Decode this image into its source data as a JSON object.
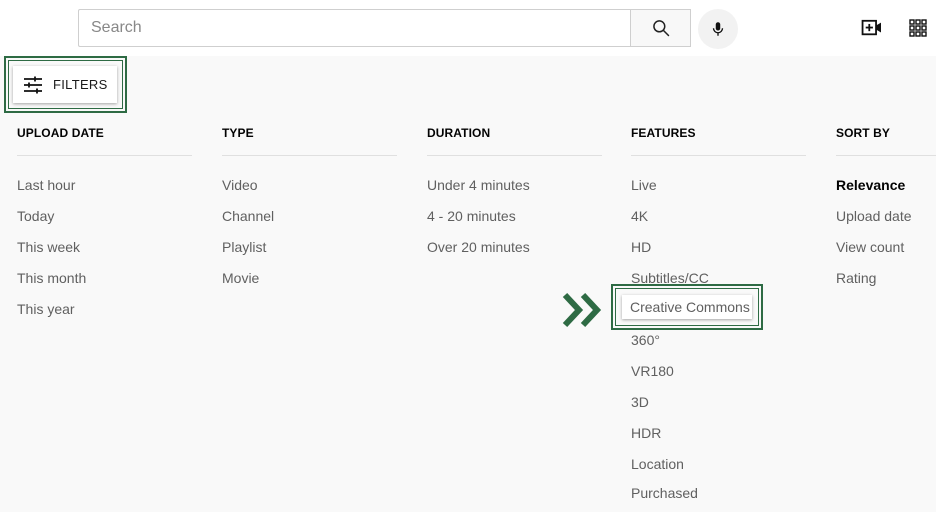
{
  "header": {
    "search_placeholder": "Search",
    "icons": [
      "search-icon",
      "mic-icon",
      "create-video-icon",
      "apps-grid-icon"
    ]
  },
  "filters_button": {
    "label": "FILTERS",
    "icon": "sliders-icon"
  },
  "columns": [
    {
      "title": "UPLOAD DATE",
      "options": [
        "Last hour",
        "Today",
        "This week",
        "This month",
        "This year"
      ]
    },
    {
      "title": "TYPE",
      "options": [
        "Video",
        "Channel",
        "Playlist",
        "Movie"
      ]
    },
    {
      "title": "DURATION",
      "options": [
        "Under 4 minutes",
        "4 - 20 minutes",
        "Over 20 minutes"
      ]
    },
    {
      "title": "FEATURES",
      "options": [
        "Live",
        "4K",
        "HD",
        "Subtitles/CC",
        "Creative Commons",
        "360°",
        "VR180",
        "3D",
        "HDR",
        "Location",
        "Purchased"
      ]
    },
    {
      "title": "SORT BY",
      "options": [
        "Relevance",
        "Upload date",
        "View count",
        "Rating"
      ],
      "selected": "Relevance"
    }
  ],
  "highlight": {
    "option": "Creative Commons",
    "color": "#2e6b44",
    "arrow_icon": "double-chevron-right-icon"
  },
  "colors": {
    "accent": "#2e6b44",
    "text_muted": "#606060",
    "text_strong": "#030303"
  }
}
